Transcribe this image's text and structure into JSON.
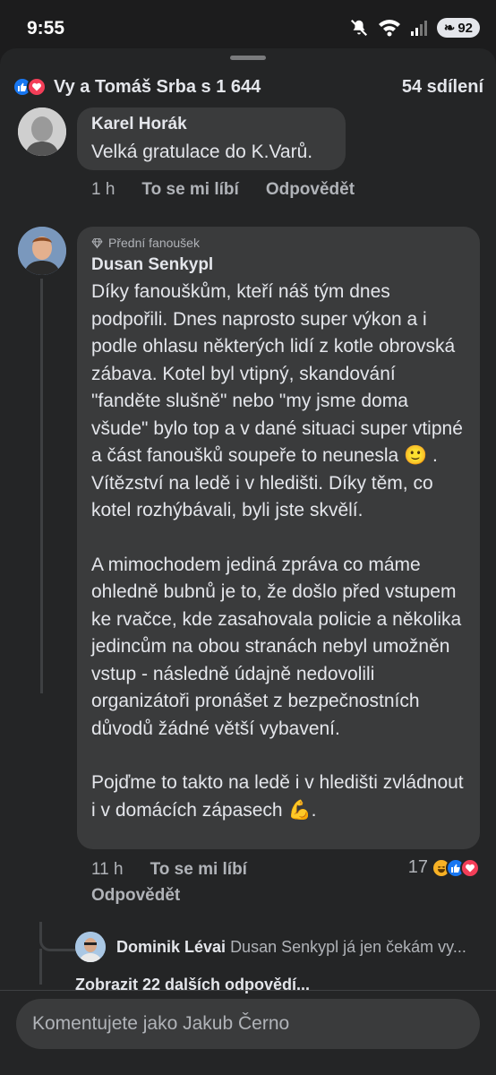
{
  "status_bar": {
    "time": "9:55",
    "battery": "92"
  },
  "reactions": {
    "summary": "Vy a Tomáš Srba s 1 644",
    "shares": "54 sdílení"
  },
  "comments": [
    {
      "author": "Karel Horák",
      "text": "Velká gratulace do K.Varů.",
      "time": "1 h",
      "like_label": "To se mi líbí",
      "reply_label": "Odpovědět"
    },
    {
      "badge": "Přední fanoušek",
      "author": "Dusan Senkypl",
      "text_p1": "Díky fanouškům, kteří náš tým dnes podpořili. Dnes naprosto super výkon a i podle ohlasu některých lidí z kotle obrovská zábava. Kotel byl vtipný, skandování \"fanděte slušně\" nebo \"my jsme doma všude\" bylo top a v dané situaci super vtipné a část fanoušků soupeře to neunesla 🙂 . Vítězství na ledě i v hledišti. Díky těm, co kotel rozhýbávali, byli jste skvělí.",
      "text_p2": "A mimochodem jediná zpráva co máme ohledně bubnů je to, že došlo před vstupem ke rvačce, kde zasahovala policie a několika jedincům na obou stranách nebyl umožněn vstup - následně údajně nedovolili organizátoři pronášet z bezpečnostních důvodů žádné větší vybavení.",
      "text_p3": "Pojďme to takto na ledě i v hledišti zvládnout i v domácích zápasech 💪.",
      "time": "11 h",
      "like_label": "To se mi líbí",
      "reply_label": "Odpovědět",
      "reaction_count": "17"
    }
  ],
  "reply_preview": {
    "author": "Dominik Lévai",
    "text": "Dusan Senkypl já jen čekám vy...",
    "more_replies": "Zobrazit 22 dalších odpovědí..."
  },
  "input": {
    "placeholder": "Komentujete jako Jakub Černo"
  },
  "colors": {
    "like": "#1877f2",
    "love": "#f33e58",
    "haha": "#f7b125",
    "bubble": "#3a3b3c",
    "sheet": "#242526"
  }
}
